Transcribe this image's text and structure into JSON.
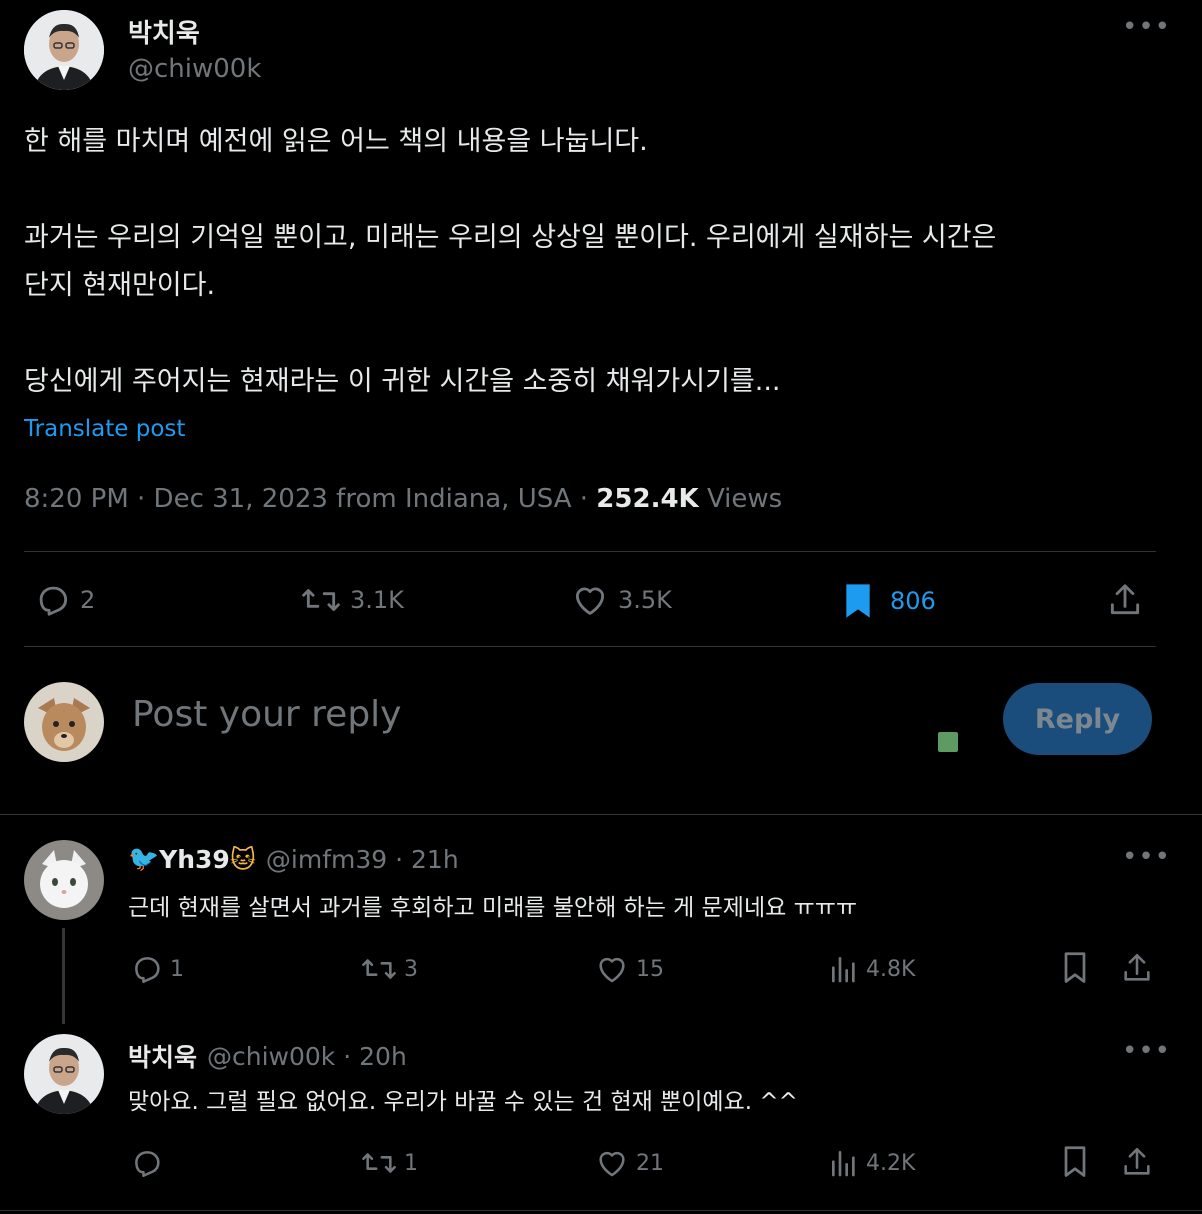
{
  "tweet": {
    "author_name": "박치욱",
    "author_handle": "@chiw00k",
    "line1": "한 해를 마치며 예전에 읽은 어느 책의 내용을 나눕니다.",
    "line2": "과거는 우리의 기억일 뿐이고, 미래는 우리의 상상일 뿐이다. 우리에게 실재하는 시간은",
    "line3": "단지 현재만이다.",
    "line4": "당신에게 주어지는 현재라는 이 귀한 시간을 소중히 채워가시기를...",
    "translate_label": "Translate post",
    "timestamp": "8:20 PM · Dec 31, 2023 from Indiana, USA · ",
    "views_count": "252.4K",
    "views_label": "Views",
    "actions": {
      "replies": "2",
      "reposts": "3.1K",
      "likes": "3.5K",
      "bookmarks": "806"
    }
  },
  "composer": {
    "placeholder": "Post your reply",
    "reply_button": "Reply"
  },
  "replies": [
    {
      "emoji_prefix": "🐦",
      "author_name": "Yh39",
      "emoji_suffix": "🐱",
      "handle_time": "@imfm39 · 21h",
      "text": "근데 현재를 살면서  과거를 후회하고 미래를 불안해 하는 게 문제네요 ㅠㅠㅠ",
      "replies": "1",
      "reposts": "3",
      "likes": "15",
      "views": "4.8K"
    },
    {
      "author_name": "박치욱",
      "handle_time": "@chiw00k · 20h",
      "text": "맞아요. 그럴 필요 없어요. 우리가 바꿀 수 있는 건 현재 뿐이예요. ^^",
      "replies": "",
      "reposts": "1",
      "likes": "21",
      "views": "4.2K"
    }
  ],
  "colors": {
    "background": "#000000",
    "text": "#e7e9ea",
    "muted": "#71767b",
    "accent": "#1d9bf0",
    "reply_button_bg": "#1a4d7c",
    "divider": "#2f3336"
  }
}
